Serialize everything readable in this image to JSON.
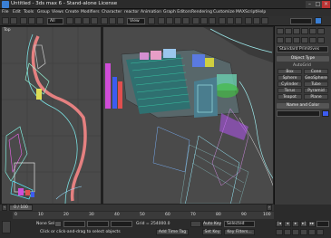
{
  "window": {
    "title": "Untitled - 3ds max 6 - Stand-alone License"
  },
  "menu": [
    "File",
    "Edit",
    "Tools",
    "Group",
    "Views",
    "Create",
    "Modifiers",
    "Character",
    "reactor",
    "Animation",
    "Graph Editors",
    "Rendering",
    "Customize",
    "MAXScript",
    "Help"
  ],
  "toolbar": {
    "selection_filter": "All",
    "ref_coord": "View"
  },
  "viewports": {
    "top_label": "Top",
    "persp_label": "Perspective"
  },
  "command_panel": {
    "category": "Standard Primitives",
    "rollout_object_type": "Object Type",
    "autogrid_label": "AutoGrid",
    "buttons": [
      "Box",
      "Cone",
      "Sphere",
      "GeoSphere",
      "Cylinder",
      "Tube",
      "Torus",
      "Pyramid",
      "Teapot",
      "Plane"
    ],
    "rollout_name_color": "Name and Color"
  },
  "timeline": {
    "frame_display": "0 / 100",
    "ticks": [
      "0",
      "10",
      "20",
      "30",
      "40",
      "50",
      "60",
      "70",
      "80",
      "90",
      "100"
    ]
  },
  "status": {
    "selection": "None Sel",
    "prompt": "Click or click-and-drag to select objects",
    "grid": "Grid = 254000.0",
    "add_time_tag": "Add Time Tag",
    "auto_key": "Auto Key",
    "auto_key_mode": "Selected",
    "set_key": "Set Key",
    "key_filters": "Key Filters..."
  },
  "colors": {
    "accent_blue": "#3a7fd5",
    "auto_key_red": "#8a1d1d",
    "viewport_bg": "#4a4a4a"
  }
}
